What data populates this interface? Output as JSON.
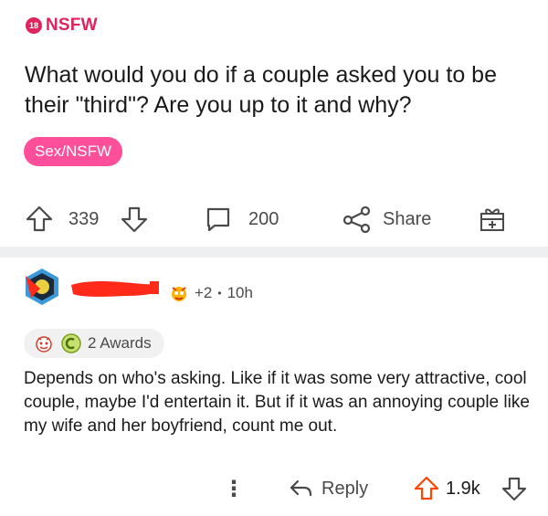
{
  "post": {
    "nsfw_badge": "18",
    "nsfw_label": "NSFW",
    "title": "What would you do if a couple asked you to be their \"third\"? Are you up to it and why?",
    "flair": "Sex/NSFW",
    "score": "339",
    "comments": "200",
    "share_label": "Share"
  },
  "comment": {
    "extra_awards": "+2",
    "dot": "•",
    "age": "10h",
    "awards_label": "2 Awards",
    "body": "Depends on who's asking. Like if it was some very attractive, cool couple, maybe I'd entertain it. But if it was an annoying couple like my wife and her boyfriend, count me out.",
    "reply_label": "Reply",
    "score": "1.9k",
    "more_glyph": "⋮"
  },
  "colors": {
    "nsfw": "#e0245e",
    "flair_bg": "#ff4f9a",
    "separator": "#edeff1",
    "icon": "#4a4a4a"
  }
}
